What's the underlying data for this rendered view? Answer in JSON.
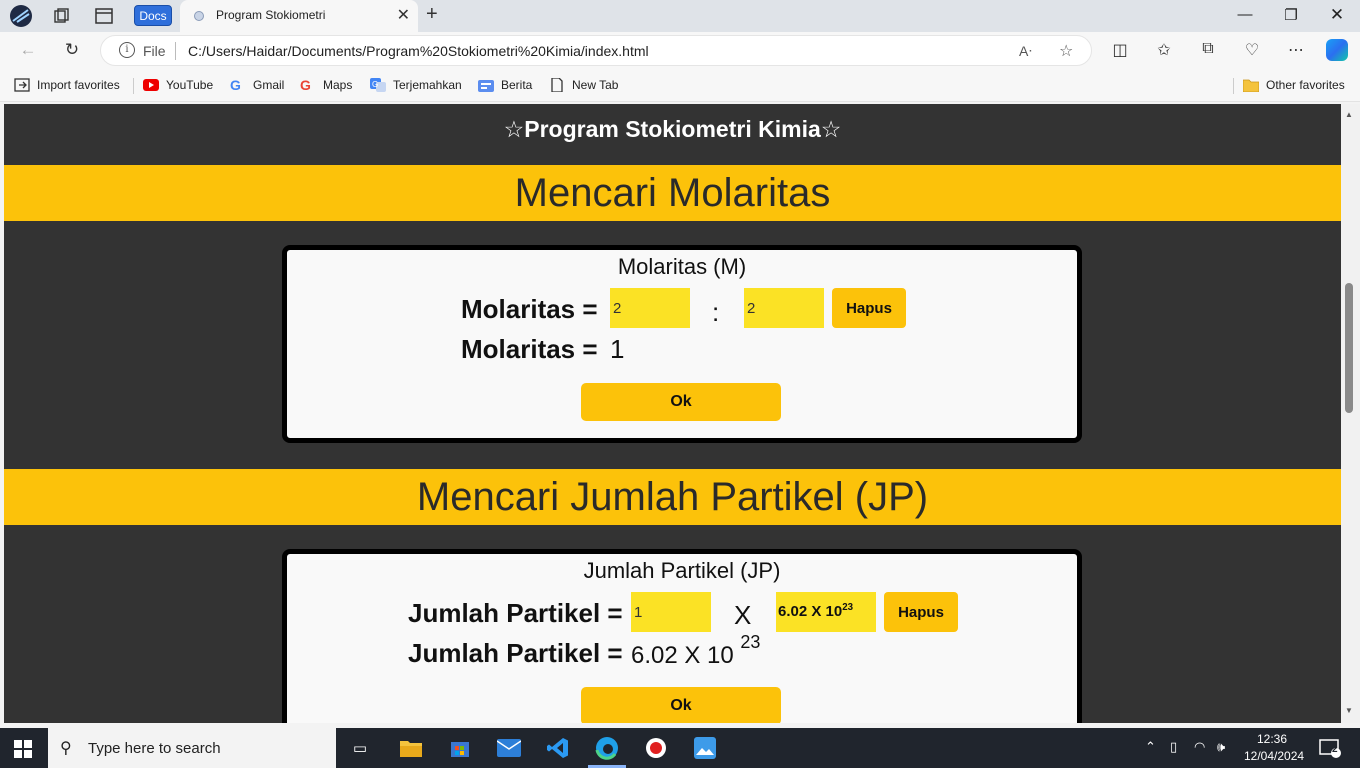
{
  "browser": {
    "docs_label": "Docs",
    "tab_title": "Program Stokiometri",
    "url_scheme": "File",
    "url": "C:/Users/Haidar/Documents/Program%20Stokiometri%20Kimia/index.html",
    "favorites": [
      {
        "label": "Import favorites",
        "icon": "import-icon"
      },
      {
        "label": "YouTube",
        "icon": "youtube-icon"
      },
      {
        "label": "Gmail",
        "icon": "google-icon"
      },
      {
        "label": "Maps",
        "icon": "google-icon"
      },
      {
        "label": "Terjemahkan",
        "icon": "translate-icon"
      },
      {
        "label": "Berita",
        "icon": "news-icon"
      },
      {
        "label": "New Tab",
        "icon": "page-icon"
      }
    ],
    "other_favorites": "Other favorites"
  },
  "page": {
    "site_title": "☆Program Stokiometri Kimia☆",
    "molaritas": {
      "heading": "Mencari Molaritas",
      "card_title": "Molaritas (M)",
      "label": "Molaritas =",
      "input1": "2",
      "operator": ":",
      "input2": "2",
      "hapus": "Hapus",
      "result_label": "Molaritas =",
      "result_value": "1",
      "ok": "Ok"
    },
    "jp": {
      "heading": "Mencari Jumlah Partikel (JP)",
      "card_title": "Jumlah Partikel (JP)",
      "label": "Jumlah Partikel =",
      "input1": "1",
      "operator": "X",
      "constant_base": "6.02 X 10",
      "constant_exp": "23",
      "hapus": "Hapus",
      "result_label": "Jumlah Partikel =",
      "result_base": "6.02 X 10",
      "result_exp": "23",
      "ok": "Ok"
    }
  },
  "taskbar": {
    "search_placeholder": "Type here to search",
    "time": "12:36",
    "date": "12/04/2024",
    "notification_count": "2"
  },
  "colors": {
    "accent_yellow": "#fcc20a",
    "input_yellow": "#fbe225",
    "page_bg": "#333333"
  }
}
